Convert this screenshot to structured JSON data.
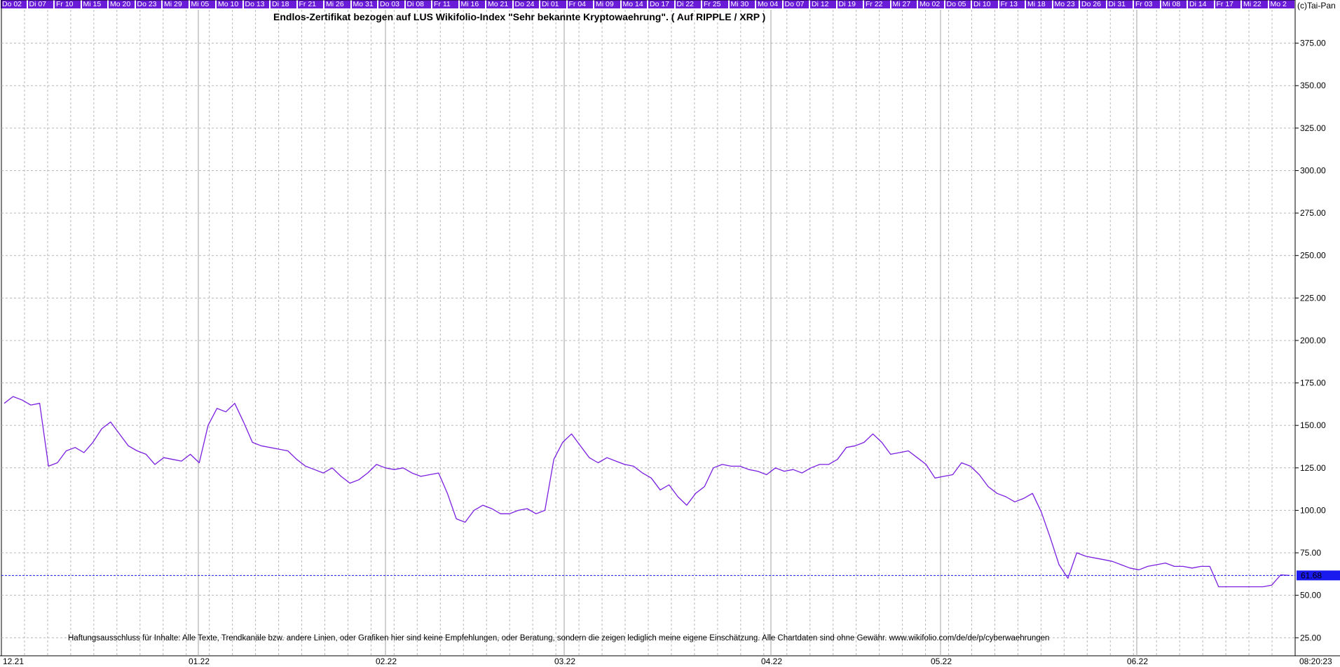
{
  "copyright": "(c)Tai-Pan",
  "day_labels": [
    "Do 02",
    "Di 07",
    "Fr 10",
    "Mi 15",
    "Mo 20",
    "Do 23",
    "Mi 29",
    "Mi 05",
    "Mo 10",
    "Do 13",
    "Di 18",
    "Fr 21",
    "Mi 26",
    "Mo 31",
    "Do 03",
    "Di 08",
    "Fr 11",
    "Mi 16",
    "Mo 21",
    "Do 24",
    "Di 01",
    "Fr 04",
    "Mi 09",
    "Mo 14",
    "Do 17",
    "Di 22",
    "Fr 25",
    "Mi 30",
    "Mo 04",
    "Do 07",
    "Di 12",
    "Di 19",
    "Fr 22",
    "Mi 27",
    "Mo 02",
    "Do 05",
    "Di 10",
    "Fr 13",
    "Mi 18",
    "Mo 23",
    "Do 26",
    "Di 31",
    "Fr 03",
    "Mi 08",
    "Di 14",
    "Fr 17",
    "Mi 22",
    "Mo 2"
  ],
  "disclaimer": "Haftungsausschluss für Inhalte: Alle Texte, Trendkanäle bzw. andere Linien, oder Grafiken hier sind keine Empfehlungen, oder Beratung, sondern die zeigen lediglich meine eigene Einschätzung. Alle Chartdaten sind ohne Gewähr.  www.wikifolio.com/de/de/p/cyberwaehrungen",
  "colors": {
    "line": "#7a1fe0",
    "label_bg": "#6a1bd8",
    "price_tag": "#1a1aee",
    "grid": "#b8b8b8"
  },
  "chart_data": {
    "type": "line",
    "title": "Endlos-Zertifikat bezogen auf LUS Wikifolio-Index \"Sehr bekannte Kryptowaehrung\". ( Auf RIPPLE / XRP )",
    "ylim": [
      25,
      400
    ],
    "yticks": [
      "375.00",
      "350.00",
      "325.00",
      "300.00",
      "275.00",
      "250.00",
      "225.00",
      "200.00",
      "175.00",
      "150.00",
      "125.00",
      "100.00",
      "75.00",
      "50.00",
      "25.00"
    ],
    "x_tick_labels": [
      "12.21",
      "01.22",
      "02.22",
      "03.22",
      "04.22",
      "05.22",
      "06.22"
    ],
    "last_value": "61.68",
    "time_label": "08:20:23",
    "grid": true,
    "series": [
      {
        "values": [
          163,
          167,
          165,
          162,
          163,
          126,
          128,
          135,
          137,
          134,
          140,
          148,
          152,
          145,
          138,
          135,
          133,
          127,
          131,
          130,
          129,
          133,
          128,
          150,
          160,
          158,
          163,
          152,
          140,
          138,
          137,
          136,
          135,
          130,
          126,
          124,
          122,
          125,
          120,
          116,
          118,
          122,
          127,
          125,
          124,
          125,
          122,
          120,
          121,
          122,
          110,
          95,
          93,
          100,
          103,
          101,
          98,
          98,
          100,
          101,
          98,
          100,
          130,
          140,
          145,
          138,
          131,
          128,
          131,
          129,
          127,
          126,
          122,
          119,
          112,
          115,
          108,
          103,
          110,
          114,
          125,
          127,
          126,
          126,
          124,
          123,
          121,
          125,
          123,
          124,
          122,
          125,
          127,
          127,
          130,
          137,
          138,
          140,
          145,
          140,
          133,
          134,
          135,
          131,
          127,
          119,
          120,
          121,
          128,
          126,
          121,
          114,
          110,
          108,
          105,
          107,
          110,
          99,
          84,
          68,
          60,
          75,
          73,
          72,
          71,
          70,
          68,
          66,
          65,
          67,
          68,
          69,
          67,
          67,
          66,
          67,
          67,
          55,
          55,
          55,
          55,
          55,
          55,
          56,
          62,
          61.68
        ]
      }
    ]
  }
}
